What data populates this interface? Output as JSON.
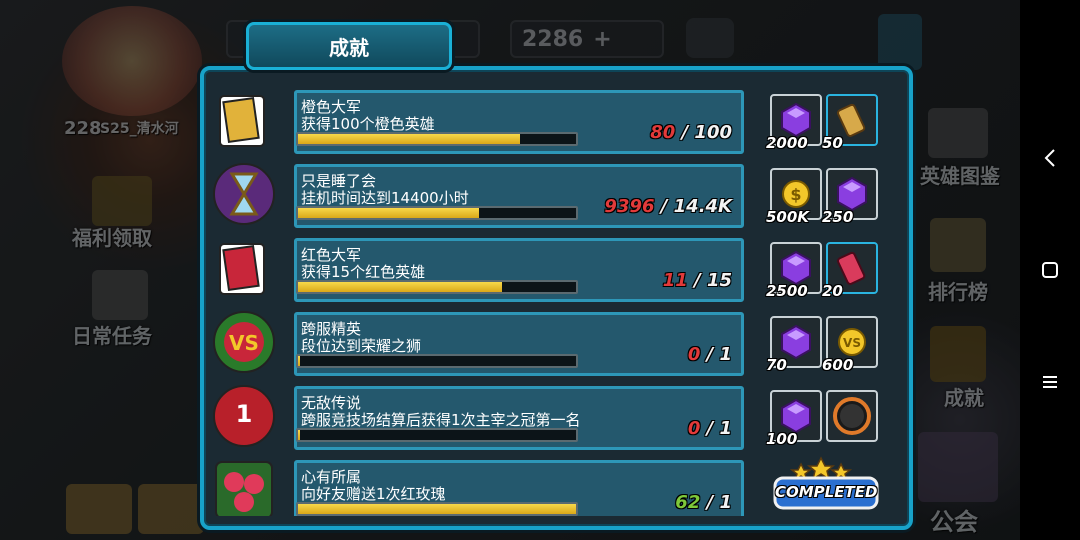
{
  "title": "成就",
  "background": {
    "currency": [
      {
        "value": "2286"
      }
    ],
    "player": {
      "level": "228",
      "name": "S25_清水河"
    },
    "left_menu": [
      "福利领取",
      "日常任务"
    ],
    "right_menu": [
      "英雄图鉴",
      "排行榜",
      "成就",
      "公会"
    ]
  },
  "achievements": [
    {
      "name": "橙色大军",
      "desc": "获得100个橙色英雄",
      "current": "80",
      "max": "100",
      "progress": 0.8,
      "cur_color": "red",
      "rewards": [
        {
          "icon": "purple-gem-icon",
          "amount": "2000"
        },
        {
          "icon": "scroll-icon",
          "amount": "50",
          "highlight": true
        }
      ]
    },
    {
      "name": "只是睡了会",
      "desc": "挂机时间达到14400小时",
      "current": "9396",
      "max": "14.4K",
      "progress": 0.65,
      "cur_color": "red",
      "rewards": [
        {
          "icon": "gold-coin-icon",
          "amount": "500K"
        },
        {
          "icon": "purple-gem-icon",
          "amount": "250"
        }
      ]
    },
    {
      "name": "红色大军",
      "desc": "获得15个红色英雄",
      "current": "11",
      "max": "15",
      "progress": 0.733,
      "cur_color": "red",
      "rewards": [
        {
          "icon": "purple-gem-icon",
          "amount": "2500"
        },
        {
          "icon": "red-scroll-icon",
          "amount": "20",
          "highlight": true
        }
      ]
    },
    {
      "name": "跨服精英",
      "desc": "段位达到荣耀之狮",
      "current": "0",
      "max": "1",
      "progress": 0,
      "cur_color": "red",
      "rewards": [
        {
          "icon": "purple-gem-icon",
          "amount": "70"
        },
        {
          "icon": "vs-coin-icon",
          "amount": "600"
        }
      ]
    },
    {
      "name": "无敌传说",
      "desc": "跨服竞技场结算后获得1次主宰之冠第一名",
      "current": "0",
      "max": "1",
      "progress": 0,
      "cur_color": "red",
      "rewards": [
        {
          "icon": "purple-gem-icon",
          "amount": "100"
        },
        {
          "icon": "avatar-frame-icon",
          "amount": ""
        }
      ]
    },
    {
      "name": "心有所属",
      "desc": "向好友赠送1次红玫瑰",
      "current": "62",
      "max": "1",
      "progress": 1,
      "cur_color": "green",
      "rewards": [],
      "completed_label": "COMPLETED"
    }
  ],
  "colors": {
    "panel_border": "#18a2c9",
    "row_bg": "#24586d",
    "bar_fill": "#f7d84a",
    "progress_red": "#e23a3a",
    "progress_green": "#7ec93a"
  }
}
